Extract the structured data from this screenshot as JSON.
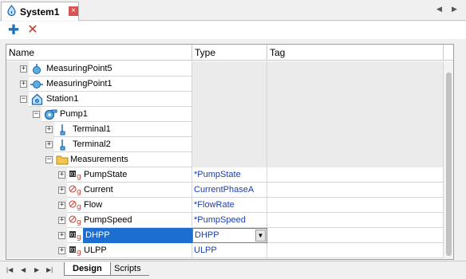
{
  "window": {
    "tab_title": "System1",
    "tab_close": "×",
    "nav_left": "◀",
    "nav_right": "▶"
  },
  "toolbar": {
    "add_icon": "plus-icon",
    "add_glyph": "✚",
    "delete_icon": "delete-x-icon",
    "delete_glyph": "✕"
  },
  "grid": {
    "columns": {
      "name": "Name",
      "type": "Type",
      "tag": "Tag"
    },
    "rows": [
      {
        "label": "MeasuringPoint5",
        "type": "",
        "icon": "measuring-point-icon",
        "expander": "+"
      },
      {
        "label": "MeasuringPoint1",
        "type": "",
        "icon": "measuring-point-icon",
        "expander": "+"
      },
      {
        "label": "Station1",
        "type": "",
        "icon": "station-icon",
        "expander": "−"
      },
      {
        "label": "Pump1",
        "type": "",
        "icon": "pump-icon",
        "expander": "−"
      },
      {
        "label": "Terminal1",
        "type": "",
        "icon": "terminal-icon",
        "expander": "+"
      },
      {
        "label": "Terminal2",
        "type": "",
        "icon": "terminal-icon",
        "expander": "+"
      },
      {
        "label": "Measurements",
        "type": "",
        "icon": "folder-icon",
        "expander": "−"
      },
      {
        "label": "PumpState",
        "type": "*PumpState",
        "icon": "digital-signal-icon",
        "expander": "+"
      },
      {
        "label": "Current",
        "type": "CurrentPhaseA",
        "icon": "analog-signal-icon",
        "expander": "+"
      },
      {
        "label": "Flow",
        "type": "*FlowRate",
        "icon": "analog-signal-icon",
        "expander": "+"
      },
      {
        "label": "PumpSpeed",
        "type": "*PumpSpeed",
        "icon": "analog-signal-icon",
        "expander": "+"
      },
      {
        "label": "DHPP",
        "type": "DHPP",
        "icon": "digital-signal-icon",
        "expander": "+"
      },
      {
        "label": "ULPP",
        "type": "ULPP",
        "icon": "digital-signal-icon",
        "expander": "+"
      }
    ],
    "dropdown_glyph": "▼"
  },
  "bottom": {
    "nav": [
      "|◀",
      "◀",
      "▶",
      "▶|"
    ],
    "tabs": [
      "Design",
      "Scripts"
    ]
  },
  "colors": {
    "selection": "#1c6fd1",
    "type_text": "#1a3fae",
    "add": "#1e73be",
    "delete": "#c0392b"
  }
}
